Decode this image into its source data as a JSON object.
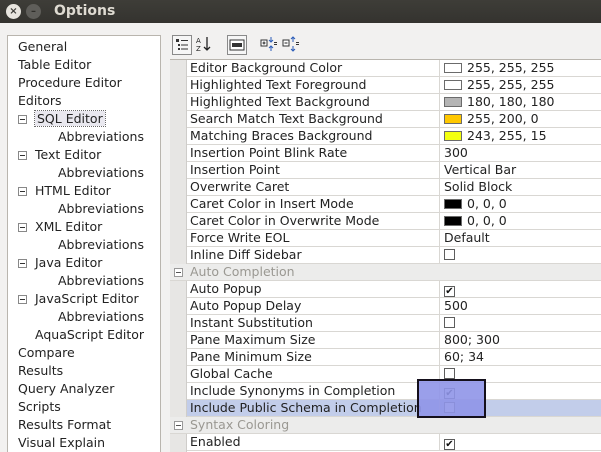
{
  "window": {
    "title": "Options",
    "close_icon": "close-icon",
    "minimize_icon": "minimize-icon"
  },
  "tree": [
    {
      "label": "General",
      "level": 0,
      "expander": false,
      "selected": false
    },
    {
      "label": "Table Editor",
      "level": 0,
      "expander": false,
      "selected": false
    },
    {
      "label": "Procedure Editor",
      "level": 0,
      "expander": false,
      "selected": false
    },
    {
      "label": "Editors",
      "level": 0,
      "expander": false,
      "selected": false
    },
    {
      "label": "SQL Editor",
      "level": 1,
      "expander": true,
      "selected": true
    },
    {
      "label": "Abbreviations",
      "level": 2,
      "expander": false,
      "selected": false
    },
    {
      "label": "Text Editor",
      "level": 1,
      "expander": true,
      "selected": false
    },
    {
      "label": "Abbreviations",
      "level": 2,
      "expander": false,
      "selected": false
    },
    {
      "label": "HTML Editor",
      "level": 1,
      "expander": true,
      "selected": false
    },
    {
      "label": "Abbreviations",
      "level": 2,
      "expander": false,
      "selected": false
    },
    {
      "label": "XML Editor",
      "level": 1,
      "expander": true,
      "selected": false
    },
    {
      "label": "Abbreviations",
      "level": 2,
      "expander": false,
      "selected": false
    },
    {
      "label": "Java Editor",
      "level": 1,
      "expander": true,
      "selected": false
    },
    {
      "label": "Abbreviations",
      "level": 2,
      "expander": false,
      "selected": false
    },
    {
      "label": "JavaScript Editor",
      "level": 1,
      "expander": true,
      "selected": false
    },
    {
      "label": "Abbreviations",
      "level": 2,
      "expander": false,
      "selected": false
    },
    {
      "label": "AquaScript Editor",
      "level": 1,
      "expander": false,
      "selected": false
    },
    {
      "label": "Compare",
      "level": 0,
      "expander": false,
      "selected": false
    },
    {
      "label": "Results",
      "level": 0,
      "expander": false,
      "selected": false
    },
    {
      "label": "Query Analyzer",
      "level": 0,
      "expander": false,
      "selected": false
    },
    {
      "label": "Scripts",
      "level": 0,
      "expander": false,
      "selected": false
    },
    {
      "label": "Results Format",
      "level": 0,
      "expander": false,
      "selected": false
    },
    {
      "label": "Visual Explain",
      "level": 0,
      "expander": false,
      "selected": false
    }
  ],
  "toolbar": [
    {
      "icon": "categorized-view-icon",
      "boxed": true
    },
    {
      "icon": "sort-alphabetical-icon",
      "boxed": false
    },
    {
      "icon": "property-pages-icon",
      "boxed": true
    },
    {
      "icon": "expand-all-icon",
      "boxed": false
    },
    {
      "icon": "collapse-all-icon",
      "boxed": false
    }
  ],
  "properties": [
    {
      "kind": "prop",
      "name": "Editor Background Color",
      "type": "color",
      "value": "255, 255, 255",
      "color": "#ffffff"
    },
    {
      "kind": "prop",
      "name": "Highlighted Text Foreground",
      "type": "color",
      "value": "255, 255, 255",
      "color": "#ffffff"
    },
    {
      "kind": "prop",
      "name": "Highlighted Text Background",
      "type": "color",
      "value": "180, 180, 180",
      "color": "#b4b4b4"
    },
    {
      "kind": "prop",
      "name": "Search Match Text Background",
      "type": "color",
      "value": "255, 200, 0",
      "color": "#ffc800"
    },
    {
      "kind": "prop",
      "name": "Matching Braces Background",
      "type": "color",
      "value": "243, 255, 15",
      "color": "#f3ff0f"
    },
    {
      "kind": "prop",
      "name": "Insertion Point Blink Rate",
      "type": "text",
      "value": "300"
    },
    {
      "kind": "prop",
      "name": "Insertion Point",
      "type": "text",
      "value": "Vertical Bar"
    },
    {
      "kind": "prop",
      "name": "Overwrite Caret",
      "type": "text",
      "value": "Solid Block"
    },
    {
      "kind": "prop",
      "name": "Caret Color in Insert Mode",
      "type": "color",
      "value": "0, 0, 0",
      "color": "#000000"
    },
    {
      "kind": "prop",
      "name": "Caret Color in Overwrite Mode",
      "type": "color",
      "value": "0, 0, 0",
      "color": "#000000"
    },
    {
      "kind": "prop",
      "name": "Force Write EOL",
      "type": "text",
      "value": "Default"
    },
    {
      "kind": "prop",
      "name": "Inline Diff Sidebar",
      "type": "check",
      "checked": false
    },
    {
      "kind": "category",
      "name": "Auto Completion"
    },
    {
      "kind": "prop",
      "name": "Auto Popup",
      "type": "check",
      "checked": true
    },
    {
      "kind": "prop",
      "name": "Auto Popup Delay",
      "type": "text",
      "value": "500"
    },
    {
      "kind": "prop",
      "name": "Instant Substitution",
      "type": "check",
      "checked": false
    },
    {
      "kind": "prop",
      "name": "Pane Maximum Size",
      "type": "text",
      "value": "800; 300"
    },
    {
      "kind": "prop",
      "name": "Pane Minimum Size",
      "type": "text",
      "value": "60; 34"
    },
    {
      "kind": "prop",
      "name": "Global Cache",
      "type": "check",
      "checked": false
    },
    {
      "kind": "prop",
      "name": "Include Synonyms in Completion",
      "type": "check",
      "checked": true
    },
    {
      "kind": "prop",
      "name": "Include Public Schema in Completion",
      "type": "check",
      "checked": false,
      "highlighted": true
    },
    {
      "kind": "category",
      "name": "Syntax Coloring"
    },
    {
      "kind": "prop",
      "name": "Enabled",
      "type": "check",
      "checked": true
    }
  ]
}
